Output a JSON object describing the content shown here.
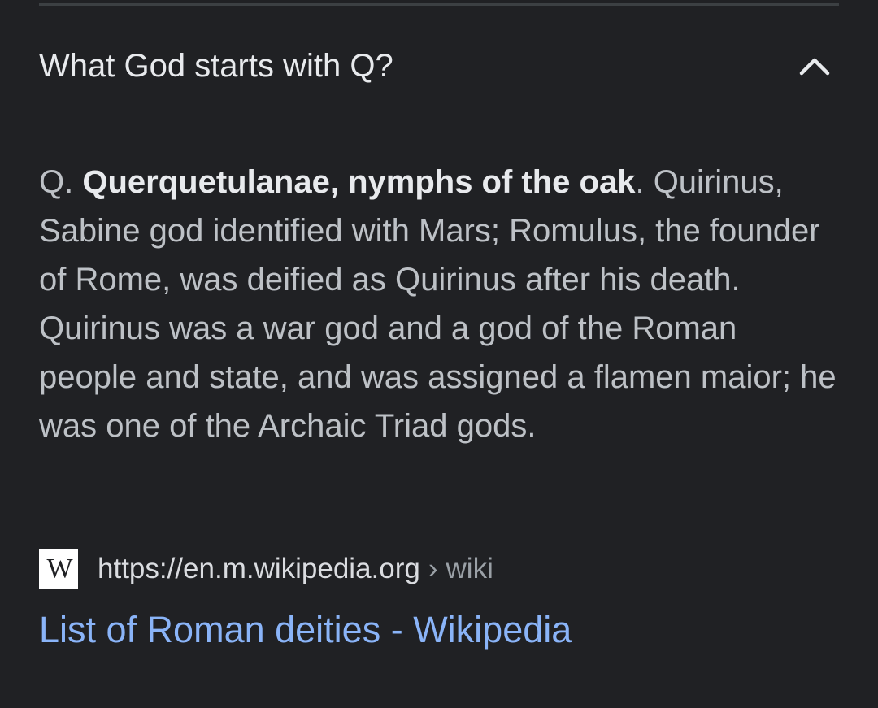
{
  "question": {
    "text": "What God starts with Q?",
    "expanded_icon": "chevron-up-icon"
  },
  "answer": {
    "prefix": "Q. ",
    "bold": "Querquetulanae, nymphs of the oak",
    "rest": ". Quirinus, Sabine god identified with Mars; Romulus, the founder of Rome, was deified as Quirinus after his death. Quirinus was a war god and a god of the Roman people and state, and was assigned a flamen maior; he was one of the Archaic Triad gods."
  },
  "source": {
    "favicon_letter": "W",
    "url": "https://en.m.wikipedia.org",
    "separator": "›",
    "path": "wiki"
  },
  "result": {
    "title": "List of Roman deities - Wikipedia"
  },
  "colors": {
    "background": "#202124",
    "link": "#8ab4f8",
    "text": "#bdc1c6",
    "heading": "#e8eaed"
  }
}
